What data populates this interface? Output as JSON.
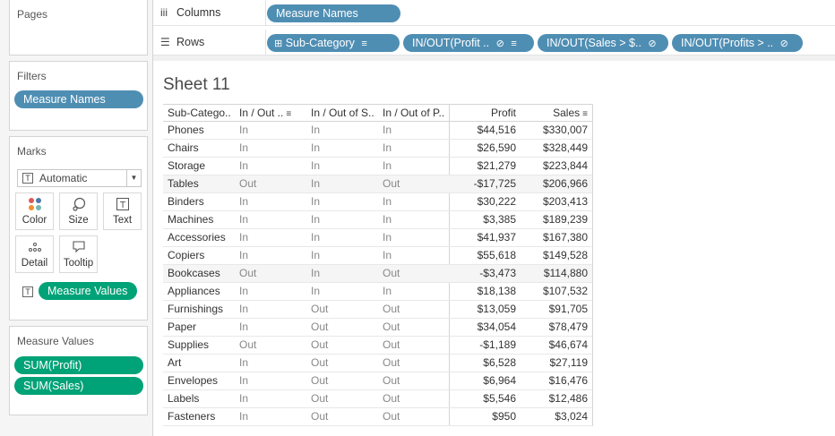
{
  "side": {
    "pages_title": "Pages",
    "filters_title": "Filters",
    "filters": [
      "Measure Names"
    ],
    "marks_title": "Marks",
    "mark_type": "Automatic",
    "mark_buttons": [
      {
        "label": "Color",
        "icon": "color-dots-icon"
      },
      {
        "label": "Size",
        "icon": "size-icon"
      },
      {
        "label": "Text",
        "icon": "text-icon"
      },
      {
        "label": "Detail",
        "icon": "detail-dots-icon"
      },
      {
        "label": "Tooltip",
        "icon": "tooltip-icon"
      }
    ],
    "mark_pill": "Measure Values",
    "measure_values_title": "Measure Values",
    "measure_values": [
      "SUM(Profit)",
      "SUM(Sales)"
    ]
  },
  "shelves": {
    "columns_label": "Columns",
    "rows_label": "Rows",
    "columns_pills": [
      "Measure Names"
    ],
    "rows_pills": [
      "Sub-Category",
      "IN/OUT(Profit ..",
      "IN/OUT(Sales > $..",
      "IN/OUT(Profits > .."
    ]
  },
  "sheet": {
    "title": "Sheet 11",
    "headers": {
      "sub": "Sub-Catego..",
      "io1": "In / Out ..",
      "io2": "In / Out of S..",
      "io3": "In / Out of P..",
      "profit": "Profit",
      "sales": "Sales"
    },
    "rows": [
      {
        "sub": "Phones",
        "io1": "In",
        "io2": "In",
        "io3": "In",
        "profit": "$44,516",
        "sales": "$330,007"
      },
      {
        "sub": "Chairs",
        "io1": "In",
        "io2": "In",
        "io3": "In",
        "profit": "$26,590",
        "sales": "$328,449"
      },
      {
        "sub": "Storage",
        "io1": "In",
        "io2": "In",
        "io3": "In",
        "profit": "$21,279",
        "sales": "$223,844"
      },
      {
        "sub": "Tables",
        "io1": "Out",
        "io2": "In",
        "io3": "Out",
        "profit": "-$17,725",
        "sales": "$206,966"
      },
      {
        "sub": "Binders",
        "io1": "In",
        "io2": "In",
        "io3": "In",
        "profit": "$30,222",
        "sales": "$203,413"
      },
      {
        "sub": "Machines",
        "io1": "In",
        "io2": "In",
        "io3": "In",
        "profit": "$3,385",
        "sales": "$189,239"
      },
      {
        "sub": "Accessories",
        "io1": "In",
        "io2": "In",
        "io3": "In",
        "profit": "$41,937",
        "sales": "$167,380"
      },
      {
        "sub": "Copiers",
        "io1": "In",
        "io2": "In",
        "io3": "In",
        "profit": "$55,618",
        "sales": "$149,528"
      },
      {
        "sub": "Bookcases",
        "io1": "Out",
        "io2": "In",
        "io3": "Out",
        "profit": "-$3,473",
        "sales": "$114,880"
      },
      {
        "sub": "Appliances",
        "io1": "In",
        "io2": "In",
        "io3": "In",
        "profit": "$18,138",
        "sales": "$107,532"
      },
      {
        "sub": "Furnishings",
        "io1": "In",
        "io2": "Out",
        "io3": "Out",
        "profit": "$13,059",
        "sales": "$91,705"
      },
      {
        "sub": "Paper",
        "io1": "In",
        "io2": "Out",
        "io3": "Out",
        "profit": "$34,054",
        "sales": "$78,479"
      },
      {
        "sub": "Supplies",
        "io1": "Out",
        "io2": "Out",
        "io3": "Out",
        "profit": "-$1,189",
        "sales": "$46,674"
      },
      {
        "sub": "Art",
        "io1": "In",
        "io2": "Out",
        "io3": "Out",
        "profit": "$6,528",
        "sales": "$27,119"
      },
      {
        "sub": "Envelopes",
        "io1": "In",
        "io2": "Out",
        "io3": "Out",
        "profit": "$6,964",
        "sales": "$16,476"
      },
      {
        "sub": "Labels",
        "io1": "In",
        "io2": "Out",
        "io3": "Out",
        "profit": "$5,546",
        "sales": "$12,486"
      },
      {
        "sub": "Fasteners",
        "io1": "In",
        "io2": "Out",
        "io3": "Out",
        "profit": "$950",
        "sales": "$3,024"
      }
    ]
  },
  "colors": {
    "dimension_pill": "#4f8eb3",
    "measure_pill": "#00a277"
  }
}
